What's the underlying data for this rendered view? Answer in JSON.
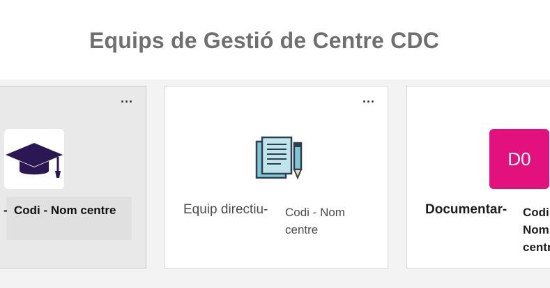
{
  "page": {
    "title": "Equips de Gestió de Centre CDC"
  },
  "cards": [
    {
      "name_prefix": "-",
      "name_suffix": "Codi - Nom centre",
      "more_label": "...",
      "icon": "graduation-cap-icon"
    },
    {
      "name_prefix": "Equip directiu-",
      "name_suffix": "Codi - Nom centre",
      "more_label": "...",
      "icon": "document-pencil-icon"
    },
    {
      "name_prefix": "Documentar-",
      "name_suffix": "Codi - Nom centre",
      "initials": "D0",
      "icon": "initials-tile"
    }
  ],
  "colors": {
    "title": "#6f6f6f",
    "initials_tile": "#e3117e",
    "cap": "#2b1754"
  }
}
